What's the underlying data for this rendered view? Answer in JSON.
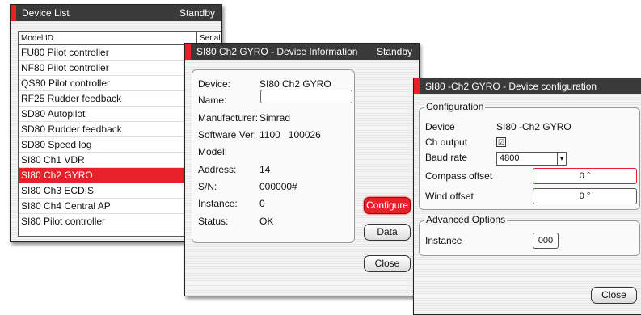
{
  "device_list": {
    "title": "Device List",
    "status": "Standby",
    "headers": {
      "model": "Model ID",
      "serial": "Serial No."
    },
    "rows": [
      "FU80 Pilot controller",
      "NF80 Pilot controller",
      "QS80 Pilot controller",
      "RF25 Rudder feedback",
      "SD80 Autopilot",
      "SD80 Rudder feedback",
      "SD80 Speed log",
      "SI80 Ch1 VDR",
      "SI80 Ch2 GYRO",
      "SI80 Ch3 ECDIS",
      "SI80 Ch4 Central AP",
      "SI80 Pilot controller"
    ],
    "selected_row": "SI80 Ch2 GYRO"
  },
  "device_info": {
    "title": "SI80 Ch2 GYRO - Device Information",
    "status": "Standby",
    "fields": {
      "device_label": "Device:",
      "device_value": "SI80 Ch2 GYRO",
      "name_label": "Name:",
      "name_value": "",
      "manufacturer_label": "Manufacturer:",
      "manufacturer_value": "Simrad",
      "software_label": "Software Ver:",
      "software_value": "1100   100026",
      "model_label": "Model:",
      "model_value": "",
      "address_label": "Address:",
      "address_value": "14",
      "sn_label": "S/N:",
      "sn_value": "000000#",
      "instance_label": "Instance:",
      "instance_value": "0",
      "status_label": "Status:",
      "status_value": "OK"
    },
    "buttons": {
      "configure": "Configure",
      "data": "Data",
      "close": "Close"
    }
  },
  "device_config": {
    "title": "SI80 -Ch2 GYRO - Device configuration",
    "configuration": {
      "title": "Configuration",
      "device_label": "Device",
      "device_value": "SI80 -Ch2 GYRO",
      "ch_output_label": "Ch output",
      "ch_output_checked": true,
      "check_glyph": "☑",
      "baud_label": "Baud rate",
      "baud_value": "4800",
      "dropdown_glyph": "▾",
      "compass_label": "Compass offset",
      "compass_value": "0 °",
      "wind_label": "Wind offset",
      "wind_value": "0 °"
    },
    "advanced": {
      "title": "Advanced Options",
      "instance_label": "Instance",
      "instance_value": "000"
    },
    "close": "Close"
  },
  "colors": {
    "accent": "#e8202a",
    "titlebar": "#3a3a3a"
  }
}
